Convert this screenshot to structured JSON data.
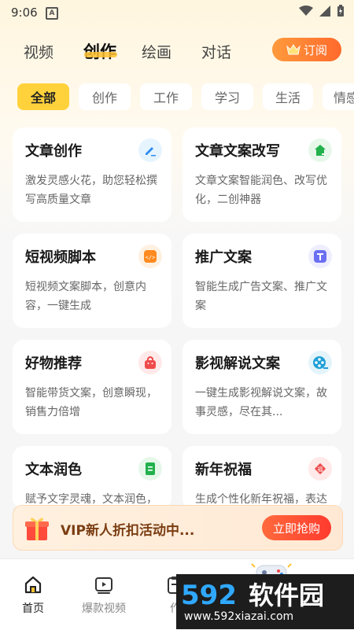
{
  "status": {
    "time": "9:06",
    "notif_letter": "A"
  },
  "topnav": {
    "tabs": [
      "视频",
      "创作",
      "绘画",
      "对话"
    ],
    "active": "创作",
    "subscribe_label": "订阅"
  },
  "chips": [
    "全部",
    "创作",
    "工作",
    "学习",
    "生活",
    "情感"
  ],
  "cards": [
    {
      "title": "文章创作",
      "desc": "激发灵感火花，助您轻松撰写高质量文章",
      "icon": "pencil-icon",
      "icon_bg": "#e6f4ff",
      "icon_color": "#2d8cf0"
    },
    {
      "title": "文章文案改写",
      "desc": "文章文案智能润色、改写优化，二创神器",
      "icon": "house-edit-icon",
      "icon_bg": "#e7f8ea",
      "icon_color": "#22b14c"
    },
    {
      "title": "短视频脚本",
      "desc": "短视频文案脚本，创意内容，一键生成",
      "icon": "code-icon",
      "icon_bg": "#fff1e2",
      "icon_color": "#ff8a1f"
    },
    {
      "title": "推广文案",
      "desc": "智能生成广告文案、推广文案",
      "icon": "text-t-icon",
      "icon_bg": "#eeeefe",
      "icon_color": "#6b6ff2"
    },
    {
      "title": "好物推荐",
      "desc": "智能带货文案，创意瞬现，销售力倍增",
      "icon": "shopping-bag-icon",
      "icon_bg": "#ffe9e9",
      "icon_color": "#ef4b4b"
    },
    {
      "title": "影视解说文案",
      "desc": "一键生成影视解说文案，故事灵感，尽在其...",
      "icon": "film-reel-icon",
      "icon_bg": "#e3f4fb",
      "icon_color": "#1f9fd6"
    },
    {
      "title": "文本润色",
      "desc": "赋予文字灵魂，文本润色，助您书写动人",
      "icon": "document-icon",
      "icon_bg": "#e7f8ea",
      "icon_color": "#22b14c"
    },
    {
      "title": "新年祝福",
      "desc": "生成个性化新年祝福，表达真挚情感",
      "icon": "fortune-icon",
      "icon_bg": "#ffe9e9",
      "icon_color": "#ef4b4b"
    }
  ],
  "banner": {
    "text": "VIP新人折扣活动中...",
    "button": "立即抢购"
  },
  "bottom_nav": [
    {
      "label": "首页",
      "icon": "home-icon",
      "active": true
    },
    {
      "label": "爆款视频",
      "icon": "video-icon",
      "active": false
    },
    {
      "label": "作",
      "icon": "document-list-icon",
      "active": false
    }
  ],
  "watermark": {
    "brand": "592软件园",
    "url": "www.592xiazai.com"
  }
}
